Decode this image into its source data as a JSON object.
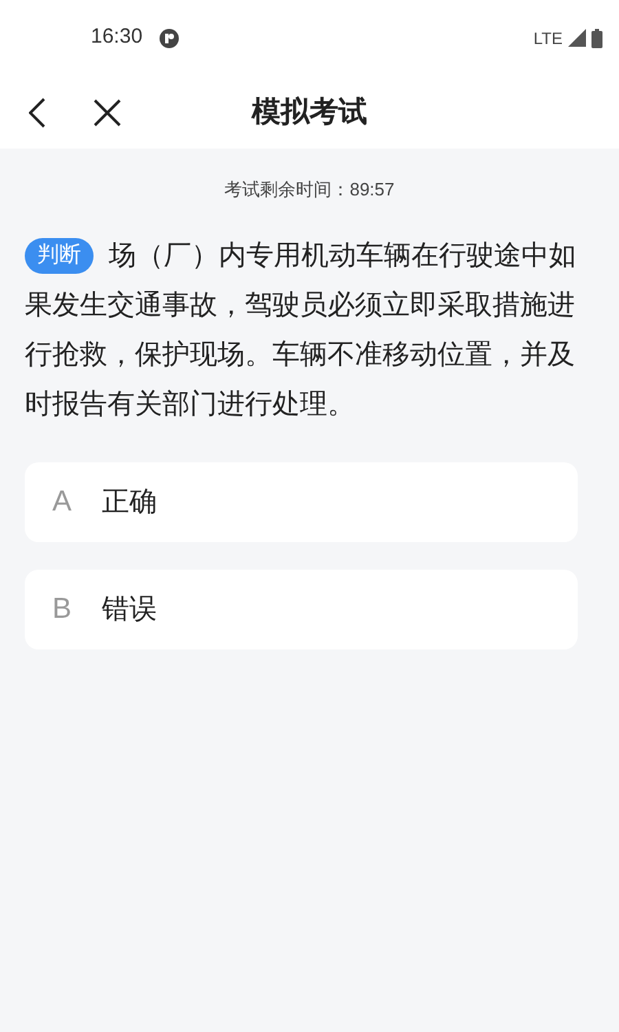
{
  "status_bar": {
    "time": "16:30",
    "network": "LTE"
  },
  "header": {
    "title": "模拟考试"
  },
  "timer": "考试剩余时间：89:57",
  "question": {
    "type_badge": "判断",
    "text": "场（厂）内专用机动车辆在行驶途中如果发生交通事故，驾驶员必须立即采取措施进行抢救，保护现场。车辆不准移动位置，并及时报告有关部门进行处理。"
  },
  "options": [
    {
      "letter": "A",
      "label": "正确",
      "selected": false
    },
    {
      "letter": "B",
      "label": "错误",
      "selected": false
    }
  ]
}
